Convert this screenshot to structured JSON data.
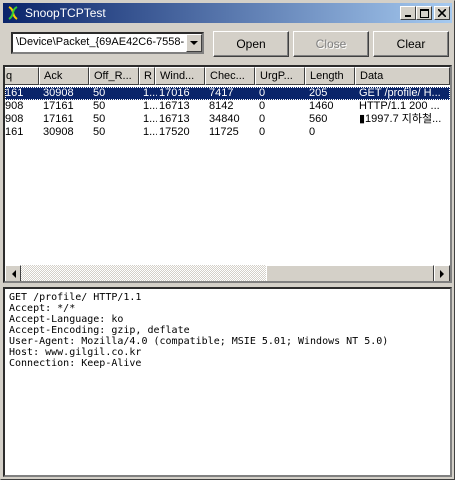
{
  "window": {
    "title": "SnoopTCPTest",
    "app_icon": "dna-app-icon"
  },
  "toolbar": {
    "adapter": "\\Device\\Packet_{69AE42C6-7558-",
    "open_label": "Open",
    "close_label": "Close",
    "clear_label": "Clear"
  },
  "grid": {
    "headers": [
      "q",
      "Ack",
      "Off_R...",
      "R",
      "Wind...",
      "Chec...",
      "UrgP...",
      "Length",
      "Data"
    ],
    "rows": [
      [
        "161",
        "30908",
        "50",
        "1...",
        "17016",
        "7417",
        "0",
        "205",
        "GET /profile/ H..."
      ],
      [
        "908",
        "17161",
        "50",
        "1...",
        "16713",
        "8142",
        "0",
        "1460",
        "HTTP/1.1 200 ..."
      ],
      [
        "908",
        "17161",
        "50",
        "1...",
        "16713",
        "34840",
        "0",
        "560",
        "▮1997.7 지하철..."
      ],
      [
        "161",
        "30908",
        "50",
        "1...",
        "17520",
        "11725",
        "0",
        "0",
        ""
      ]
    ]
  },
  "detail": {
    "lines": [
      "GET /profile/ HTTP/1.1",
      "Accept: */*",
      "Accept-Language: ko",
      "Accept-Encoding: gzip, deflate",
      "User-Agent: Mozilla/4.0 (compatible; MSIE 5.01; Windows NT 5.0)",
      "Host: www.gilgil.co.kr",
      "Connection: Keep-Alive"
    ]
  },
  "colors": {
    "selection": "#0a246a",
    "face": "#d4d0c8",
    "title_start": "#0a246a",
    "title_end": "#a6caf0"
  }
}
